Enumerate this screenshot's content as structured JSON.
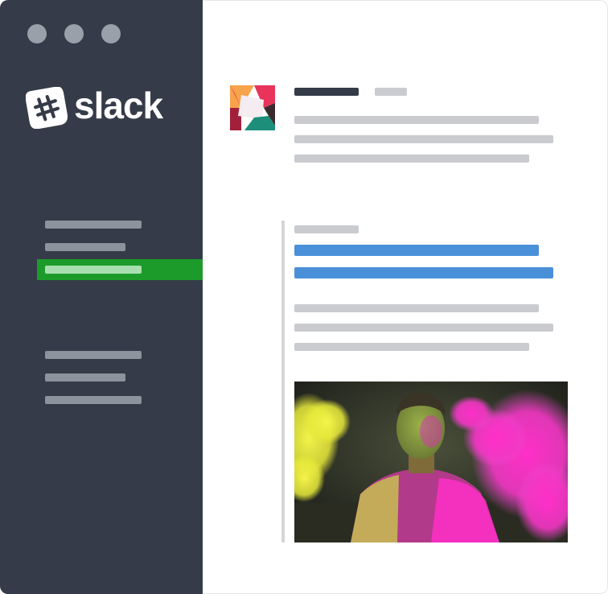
{
  "app": {
    "name": "slack"
  },
  "colors": {
    "sidebar_bg": "#353b48",
    "active_nav_bg": "#1c9b2a",
    "link_blue": "#4a90d9",
    "placeholder_gray": "#c9cbcf"
  },
  "icons": {
    "logo_mark": "slack-hash-logo-icon",
    "avatar": "multicolor-square-avatar"
  },
  "sidebar": {
    "window_controls": [
      "close",
      "minimize",
      "maximize"
    ],
    "nav_groups": [
      {
        "items": [
          "placeholder",
          "placeholder",
          "placeholder-active"
        ]
      },
      {
        "items": [
          "placeholder",
          "placeholder",
          "placeholder"
        ]
      }
    ]
  },
  "message": {
    "image_description_note": ""
  }
}
